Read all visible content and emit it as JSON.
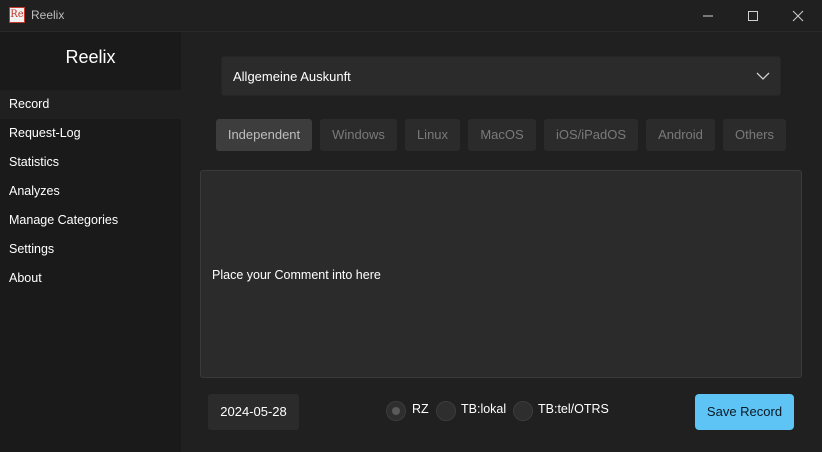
{
  "window": {
    "title": "Reelix",
    "icon_text": "Re"
  },
  "sidebar": {
    "title": "Reelix",
    "items": [
      {
        "label": "Record"
      },
      {
        "label": "Request-Log"
      },
      {
        "label": "Statistics"
      },
      {
        "label": "Analyzes"
      },
      {
        "label": "Manage Categories"
      },
      {
        "label": "Settings"
      },
      {
        "label": "About"
      }
    ]
  },
  "main": {
    "category_select": {
      "value": "Allgemeine Auskunft"
    },
    "os_tabs": [
      {
        "label": "Independent"
      },
      {
        "label": "Windows"
      },
      {
        "label": "Linux"
      },
      {
        "label": "MacOS"
      },
      {
        "label": "iOS/iPadOS"
      },
      {
        "label": "Android"
      },
      {
        "label": "Others"
      }
    ],
    "comment": {
      "placeholder": "Place your Comment into here"
    },
    "date": "2024-05-28",
    "radios": [
      {
        "label": "RZ"
      },
      {
        "label": "TB:lokal"
      },
      {
        "label": "TB:tel/OTRS"
      }
    ],
    "save_label": "Save Record"
  },
  "colors": {
    "accent": "#5dc4f5",
    "background": "#202020",
    "sidebar": "#1a1a1a"
  }
}
